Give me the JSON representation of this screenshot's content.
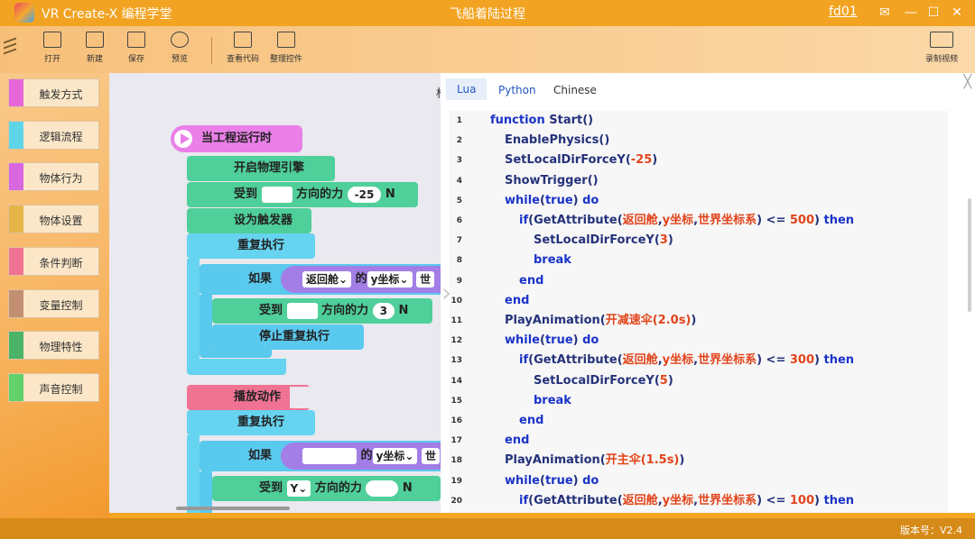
{
  "window": {
    "app_title": "VR Create-X 编程学堂",
    "doc_title": "飞船着陆过程",
    "user": "fd01"
  },
  "toolbar": {
    "items": [
      {
        "label": "打开",
        "icon": "folder-icon"
      },
      {
        "label": "新建",
        "icon": "new-file-icon"
      },
      {
        "label": "保存",
        "icon": "save-icon"
      },
      {
        "label": "预览",
        "icon": "eye-icon"
      },
      {
        "label": "查看代码",
        "icon": "view-code-icon"
      },
      {
        "label": "整理控件",
        "icon": "organize-icon"
      },
      {
        "label": "录制视频",
        "icon": "record-video-icon"
      }
    ]
  },
  "sidebar": {
    "categories": [
      {
        "label": "触发方式",
        "color": "#e766d8"
      },
      {
        "label": "逻辑流程",
        "color": "#5fd6e8"
      },
      {
        "label": "物体行为",
        "color": "#d967e0"
      },
      {
        "label": "物体设置",
        "color": "#e6b54a"
      },
      {
        "label": "条件判断",
        "color": "#f07394"
      },
      {
        "label": "变量控制",
        "color": "#c28f72"
      },
      {
        "label": "物理特性",
        "color": "#4bb368"
      },
      {
        "label": "声音控制",
        "color": "#63d16a"
      }
    ]
  },
  "workspace": {
    "title_fragment": "标",
    "blocks": {
      "on_start": "当工程运行时",
      "enable_physics": "开启物理引擎",
      "force1_label": "受到",
      "force1_dir": "方向的力",
      "force1_value": "-25",
      "force1_unit": "N",
      "set_trigger": "设为触发器",
      "repeat1": "重复执行",
      "if1": "如果",
      "if1_object": "返回舱⌄",
      "if1_of": "的",
      "if1_attr": "y坐标⌄",
      "if1_space": "世",
      "force2_label": "受到",
      "force2_dir": "方向的力",
      "force2_value": "3",
      "force2_unit": "N",
      "stop_repeat": "停止重复执行",
      "play_anim": "播放动作",
      "repeat2": "重复执行",
      "if2": "如果",
      "if2_of": "的",
      "if2_attr": "y坐标⌄",
      "if2_space": "世",
      "force3_label": "受到",
      "force3_axis": "Y⌄",
      "force3_dir": "方向的力",
      "force3_unit": "N"
    }
  },
  "code_panel": {
    "tabs": [
      "Lua",
      "Python",
      "Chinese"
    ],
    "active_tab": "Lua",
    "lines": [
      {
        "n": "1",
        "indent": 0,
        "parts": [
          [
            "kw",
            "function "
          ],
          [
            "fn",
            "Start()"
          ]
        ]
      },
      {
        "n": "2",
        "indent": 1,
        "parts": [
          [
            "fn",
            "EnablePhysics()"
          ]
        ]
      },
      {
        "n": "3",
        "indent": 1,
        "parts": [
          [
            "fn",
            "SetLocalDirForceY("
          ],
          [
            "num",
            "-25"
          ],
          [
            "fn",
            ")"
          ]
        ]
      },
      {
        "n": "4",
        "indent": 1,
        "parts": [
          [
            "fn",
            "ShowTrigger()"
          ]
        ]
      },
      {
        "n": "5",
        "indent": 1,
        "parts": [
          [
            "kw",
            "while"
          ],
          [
            "fn",
            "("
          ],
          [
            "kw",
            "true"
          ],
          [
            "fn",
            ") "
          ],
          [
            "kw",
            "do"
          ]
        ]
      },
      {
        "n": "6",
        "indent": 2,
        "parts": [
          [
            "kw",
            "if"
          ],
          [
            "fn",
            "(GetAttribute("
          ],
          [
            "str",
            "返回舱"
          ],
          [
            "fn",
            ","
          ],
          [
            "str",
            "y坐标"
          ],
          [
            "fn",
            ","
          ],
          [
            "str",
            "世界坐标系"
          ],
          [
            "fn",
            ") <= "
          ],
          [
            "num",
            "500"
          ],
          [
            "fn",
            ") "
          ],
          [
            "kw",
            "then"
          ]
        ]
      },
      {
        "n": "7",
        "indent": 3,
        "parts": [
          [
            "fn",
            "SetLocalDirForceY("
          ],
          [
            "num",
            "3"
          ],
          [
            "fn",
            ")"
          ]
        ]
      },
      {
        "n": "8",
        "indent": 3,
        "parts": [
          [
            "kw",
            "break"
          ]
        ]
      },
      {
        "n": "9",
        "indent": 2,
        "parts": [
          [
            "kw",
            "end"
          ]
        ]
      },
      {
        "n": "10",
        "indent": 1,
        "parts": [
          [
            "kw",
            "end"
          ]
        ]
      },
      {
        "n": "11",
        "indent": 1,
        "parts": [
          [
            "fn",
            "PlayAnimation("
          ],
          [
            "str",
            "开减速伞(2.0s)"
          ],
          [
            "fn",
            ")"
          ]
        ]
      },
      {
        "n": "12",
        "indent": 1,
        "parts": [
          [
            "kw",
            "while"
          ],
          [
            "fn",
            "("
          ],
          [
            "kw",
            "true"
          ],
          [
            "fn",
            ") "
          ],
          [
            "kw",
            "do"
          ]
        ]
      },
      {
        "n": "13",
        "indent": 2,
        "parts": [
          [
            "kw",
            "if"
          ],
          [
            "fn",
            "(GetAttribute("
          ],
          [
            "str",
            "返回舱"
          ],
          [
            "fn",
            ","
          ],
          [
            "str",
            "y坐标"
          ],
          [
            "fn",
            ","
          ],
          [
            "str",
            "世界坐标系"
          ],
          [
            "fn",
            ") <= "
          ],
          [
            "num",
            "300"
          ],
          [
            "fn",
            ") "
          ],
          [
            "kw",
            "then"
          ]
        ]
      },
      {
        "n": "14",
        "indent": 3,
        "parts": [
          [
            "fn",
            "SetLocalDirForceY("
          ],
          [
            "num",
            "5"
          ],
          [
            "fn",
            ")"
          ]
        ]
      },
      {
        "n": "15",
        "indent": 3,
        "parts": [
          [
            "kw",
            "break"
          ]
        ]
      },
      {
        "n": "16",
        "indent": 2,
        "parts": [
          [
            "kw",
            "end"
          ]
        ]
      },
      {
        "n": "17",
        "indent": 1,
        "parts": [
          [
            "kw",
            "end"
          ]
        ]
      },
      {
        "n": "18",
        "indent": 1,
        "parts": [
          [
            "fn",
            "PlayAnimation("
          ],
          [
            "str",
            "开主伞(1.5s)"
          ],
          [
            "fn",
            ")"
          ]
        ]
      },
      {
        "n": "19",
        "indent": 1,
        "parts": [
          [
            "kw",
            "while"
          ],
          [
            "fn",
            "("
          ],
          [
            "kw",
            "true"
          ],
          [
            "fn",
            ") "
          ],
          [
            "kw",
            "do"
          ]
        ]
      },
      {
        "n": "20",
        "indent": 2,
        "parts": [
          [
            "kw",
            "if"
          ],
          [
            "fn",
            "(GetAttribute("
          ],
          [
            "str",
            "返回舱"
          ],
          [
            "fn",
            ","
          ],
          [
            "str",
            "y坐标"
          ],
          [
            "fn",
            ","
          ],
          [
            "str",
            "世界坐标系"
          ],
          [
            "fn",
            ") <= "
          ],
          [
            "num",
            "100"
          ],
          [
            "fn",
            ") "
          ],
          [
            "kw",
            "then"
          ]
        ]
      }
    ]
  },
  "status": {
    "version": "版本号：V2.4"
  }
}
